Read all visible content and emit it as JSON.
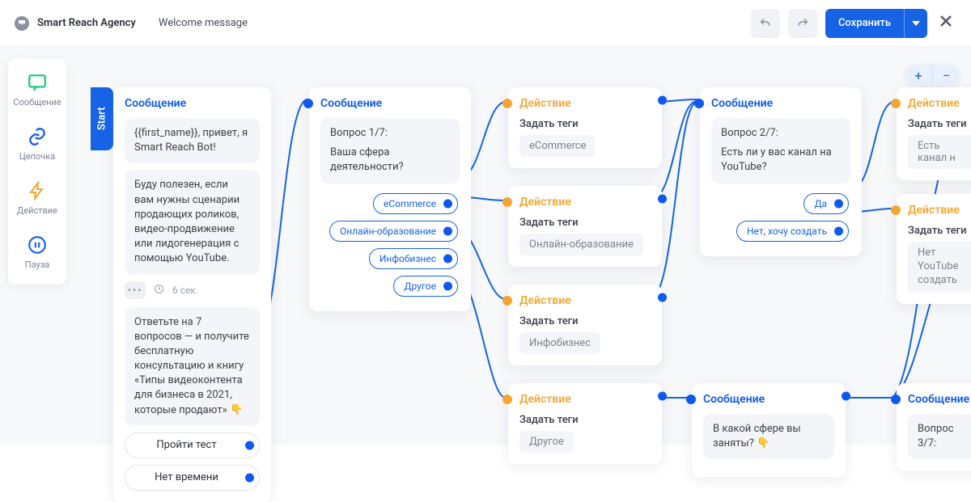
{
  "header": {
    "brand": "Smart Reach Agency",
    "subtitle": "Welcome message",
    "save_label": "Сохранить"
  },
  "toolbox": {
    "message": "Сообщение",
    "chain": "Цепочка",
    "action": "Действие",
    "pause": "Пауза"
  },
  "zoom": {
    "in": "+",
    "out": "−"
  },
  "start_tab": "Start",
  "nodes": {
    "n1": {
      "title": "Сообщение",
      "bubble1": "{{first_name}}, привет, я Smart Reach Bot!",
      "bubble2": "Буду полезен, если вам нужны сценарии продающих роликов, видео-продвижение или лидогенерация с помощью YouTube.",
      "meta_delay": "6 сек.",
      "bubble3": "Ответьте на 7 вопросов — и получите бесплатную консультацию и книгу «Типы видеоконтента для бизнеса в 2021, которые продают» 👇",
      "reply1": "Пройти тест",
      "reply2": "Нет времени"
    },
    "n2": {
      "title": "Сообщение",
      "q_label": "Вопрос 1/7:",
      "q_text": "Ваша сфера деятельности?",
      "chips": {
        "c1": "eCommerce",
        "c2": "Онлайн-образование",
        "c3": "Инфобизнес",
        "c4": "Другое"
      }
    },
    "n3": {
      "title": "Действие",
      "tag_label": "Задать теги",
      "tag": "eCommerce"
    },
    "n4": {
      "title": "Действие",
      "tag_label": "Задать теги",
      "tag": "Онлайн-образование"
    },
    "n5": {
      "title": "Действие",
      "tag_label": "Задать теги",
      "tag": "Инфобизнес"
    },
    "n6": {
      "title": "Действие",
      "tag_label": "Задать теги",
      "tag": "Другое"
    },
    "n7": {
      "title": "Сообщение",
      "q_label": "Вопрос 2/7:",
      "q_text": "Есть ли у вас канал на YouTube?",
      "chips": {
        "c1": "Да",
        "c2": "Нет, хочу создать"
      }
    },
    "n8": {
      "title": "Действие",
      "tag_label": "Задать теги",
      "tag": "Есть канал н"
    },
    "n9": {
      "title": "Действие",
      "tag_label": "Задать теги",
      "tag": "Нет YouTube создать"
    },
    "n10": {
      "title": "Сообщение",
      "text": "В какой сфере вы заняты? 👇"
    },
    "n11": {
      "title": "Сообщение",
      "q_label": "Вопрос 3/7:"
    }
  }
}
